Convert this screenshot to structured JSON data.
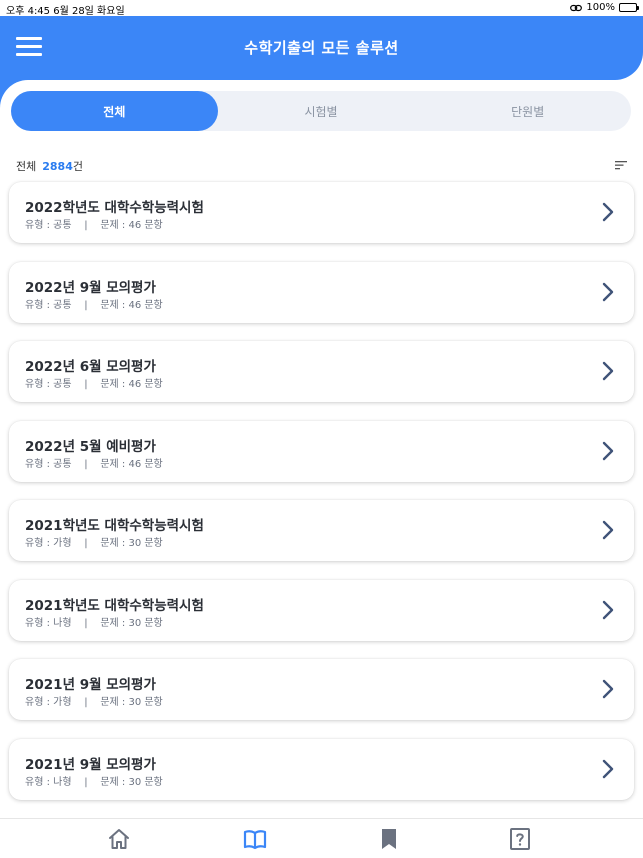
{
  "status_bar": {
    "time_date": "오후 4:45   6월 28일 화요일",
    "battery": "100%"
  },
  "header": {
    "title": "수학기출의 모든 솔루션"
  },
  "tabs": [
    {
      "label": "전체",
      "active": true
    },
    {
      "label": "시험별",
      "active": false
    },
    {
      "label": "단원별",
      "active": false
    }
  ],
  "summary": {
    "label": "전체",
    "count": "2884",
    "unit": "건"
  },
  "exams": [
    {
      "title": "2022학년도 대학수학능력시험",
      "meta": "유형 : 공통    |    문제 : 46 문항"
    },
    {
      "title": "2022년 9월 모의평가",
      "meta": "유형 : 공통    |    문제 : 46 문항"
    },
    {
      "title": "2022년 6월 모의평가",
      "meta": "유형 : 공통    |    문제 : 46 문항"
    },
    {
      "title": "2022년 5월 예비평가",
      "meta": "유형 : 공통    |    문제 : 46 문항"
    },
    {
      "title": "2021학년도 대학수학능력시험",
      "meta": "유형 : 가형    |    문제 : 30 문항"
    },
    {
      "title": "2021학년도 대학수학능력시험",
      "meta": "유형 : 나형    |    문제 : 30 문항"
    },
    {
      "title": "2021년 9월 모의평가",
      "meta": "유형 : 가형    |    문제 : 30 문항"
    },
    {
      "title": "2021년 9월 모의평가",
      "meta": "유형 : 나형    |    문제 : 30 문항"
    }
  ],
  "bottom_nav": [
    {
      "icon": "home-icon",
      "active": false
    },
    {
      "icon": "book-icon",
      "active": true
    },
    {
      "icon": "bookmark-icon",
      "active": false
    },
    {
      "icon": "question-icon",
      "active": false
    }
  ],
  "colors": {
    "accent": "#3b86f7",
    "tab_bg": "#eef1f7",
    "icon_inactive": "#6b7280"
  }
}
